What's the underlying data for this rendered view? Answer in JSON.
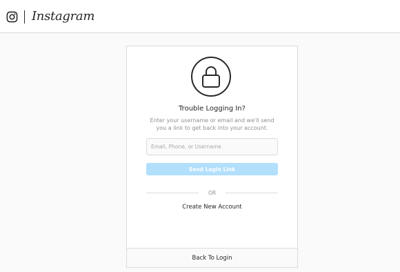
{
  "header": {
    "logo_icon": "instagram-glyph-icon",
    "wordmark": "Instagram"
  },
  "card": {
    "lock_icon": "lock-icon",
    "title": "Trouble Logging In?",
    "description": "Enter your username or email and we'll send you a link to get back into your account.",
    "input": {
      "placeholder": "Email, Phone, or Username",
      "value": ""
    },
    "send_button": "Send Login Link",
    "divider_text": "OR",
    "create_account": "Create New Account",
    "back_to_login": "Back To Login"
  },
  "colors": {
    "background": "#fafafa",
    "border": "#dbdbdb",
    "text": "#262626",
    "muted": "#8e8e8e",
    "button_disabled": "#b2dffc"
  }
}
